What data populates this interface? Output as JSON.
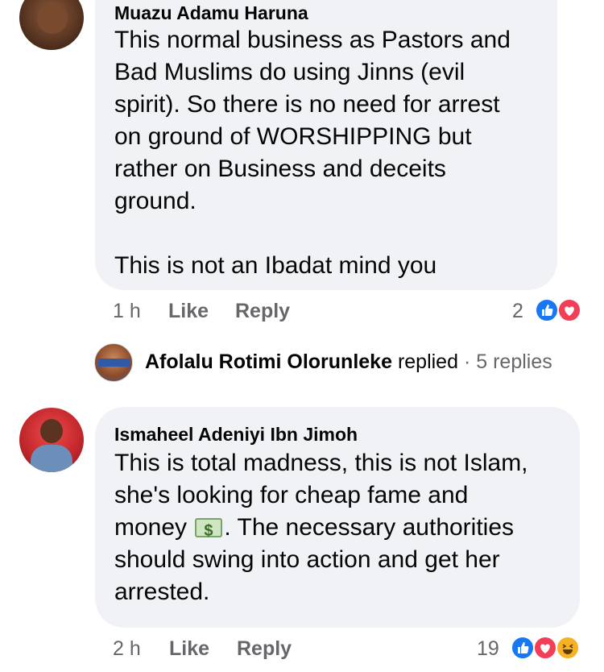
{
  "comments": [
    {
      "author": "Muazu Adamu Haruna",
      "text": "This normal business as Pastors and\nBad Muslims do using Jinns (evil\nspirit). So there is no need for arrest\non ground of WORSHIPPING but\nrather on Business and deceits\nground.\n\nThis is not an Ibadat mind you",
      "time": "1 h",
      "like_label": "Like",
      "reply_label": "Reply",
      "reaction_count": "2",
      "reactions": [
        "like-icon",
        "love-icon"
      ]
    },
    {
      "author": "Ismaheel Adeniyi Ibn Jimoh",
      "text_before_emoji": "This is total madness, this is not Islam,\nshe's looking for cheap fame and\nmoney ",
      "emoji": "money-with-wings-icon",
      "text_after_emoji": ". The necessary authorities\nshould swing into action and get her\narrested.",
      "time": "2 h",
      "like_label": "Like",
      "reply_label": "Reply",
      "reaction_count": "19",
      "reactions": [
        "like-icon",
        "love-icon",
        "haha-icon"
      ]
    }
  ],
  "replies_summary": {
    "name": "Afolalu Rotimi Olorunleke",
    "action": "replied",
    "separator": "·",
    "count_label": "5 replies"
  },
  "colors": {
    "bubble": "#f0f2f5",
    "meta_text": "#65676b",
    "like_blue": "#1877f2",
    "love_red": "#f33e58",
    "haha_yellow": "#f7b125"
  }
}
